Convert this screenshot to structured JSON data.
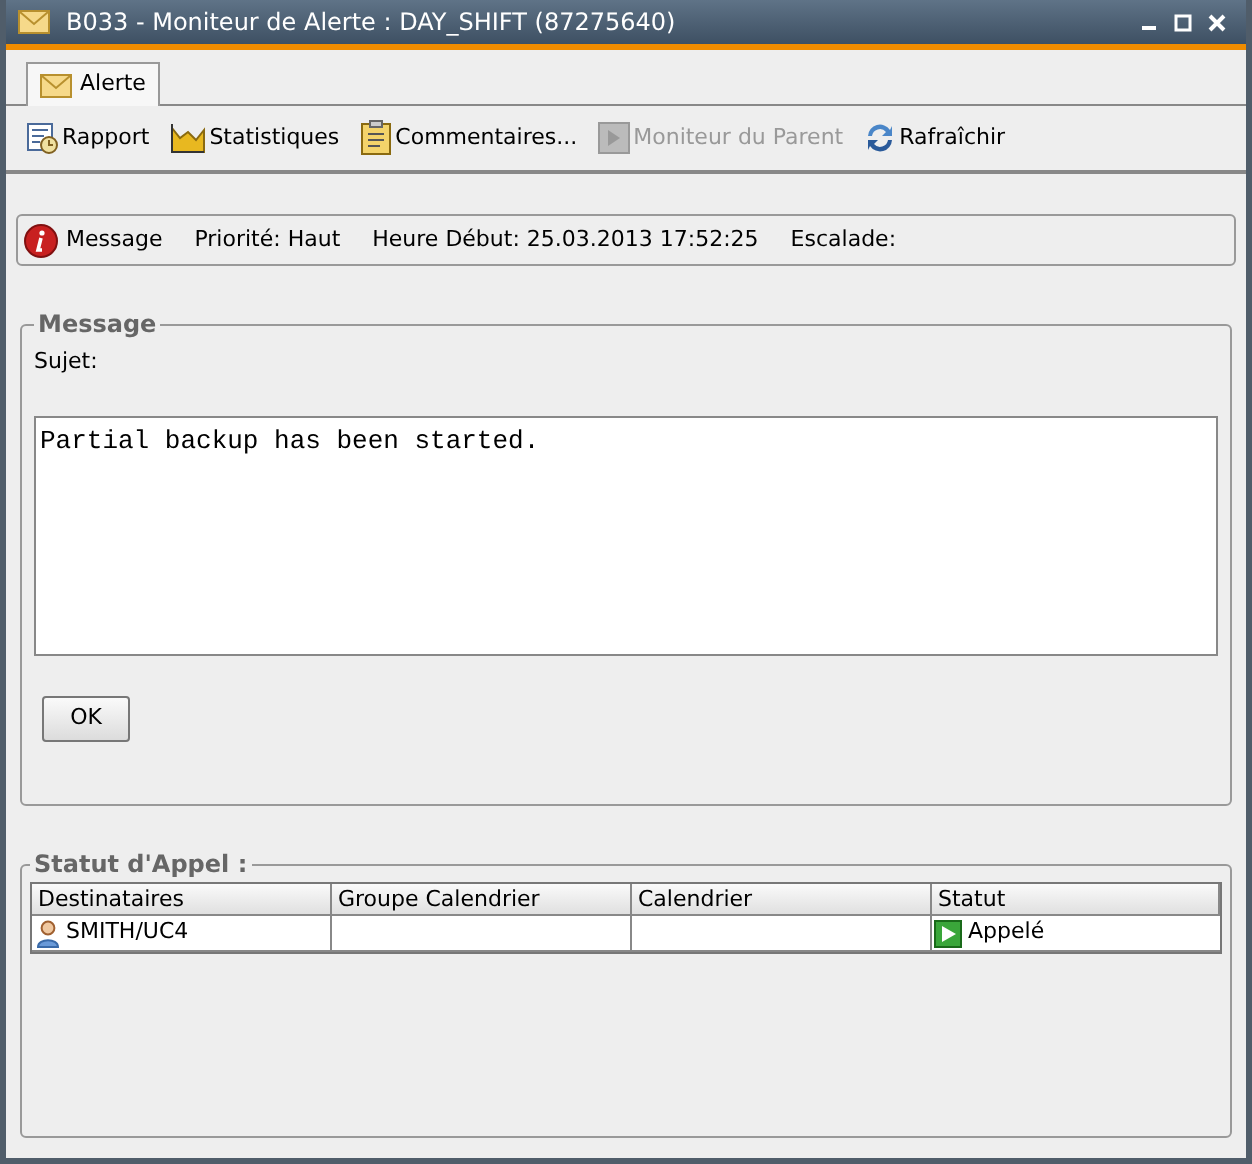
{
  "window": {
    "title": "B033 - Moniteur de Alerte : DAY_SHIFT (87275640)"
  },
  "tabs": [
    {
      "label": "Alerte",
      "selected": true
    }
  ],
  "toolbar": [
    {
      "kind": "report",
      "label": "Rapport",
      "disabled": false
    },
    {
      "kind": "chart",
      "label": "Statistiques",
      "disabled": false
    },
    {
      "kind": "clipboard",
      "label": "Commentaires...",
      "disabled": false
    },
    {
      "kind": "monitor",
      "label": "Moniteur du Parent",
      "disabled": true
    },
    {
      "kind": "refresh",
      "label": "Rafraîchir",
      "disabled": false
    }
  ],
  "info_bar": {
    "type": "Message",
    "priority": "Priorité: Haut",
    "start": "Heure Début: 25.03.2013 17:52:25",
    "escalation": "Escalade:"
  },
  "message_group": {
    "title": "Message",
    "subject_label": "Sujet:",
    "body": "Partial backup has been started.",
    "ok_button": "OK"
  },
  "call_status": {
    "title": "Statut d'Appel :",
    "columns": [
      "Destinataires",
      "Groupe Calendrier",
      "Calendrier",
      "Statut"
    ],
    "rows": [
      {
        "recipient": "SMITH/UC4",
        "group": "",
        "calendar": "",
        "status": "Appelé"
      }
    ]
  }
}
